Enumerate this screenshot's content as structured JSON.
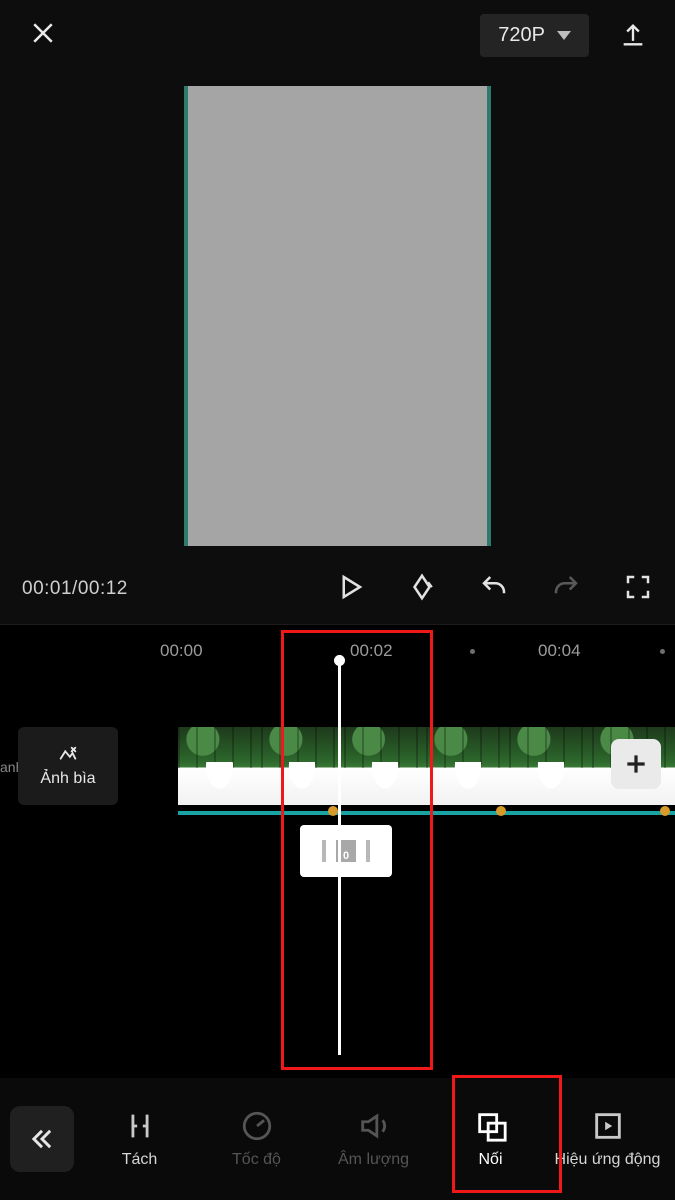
{
  "top": {
    "resolution": "720P"
  },
  "playback": {
    "time": "00:01/00:12"
  },
  "ruler": {
    "t0": "00:00",
    "t1": "00:02",
    "t2": "00:04"
  },
  "cover": {
    "label": "Ảnh bìa",
    "edge": "anh"
  },
  "transition": {
    "value": "0"
  },
  "tools": {
    "t1": "Tách",
    "t2": "Tốc độ",
    "t3": "Âm lượng",
    "t4": "Nối",
    "t5": "Hiệu ứng động"
  }
}
